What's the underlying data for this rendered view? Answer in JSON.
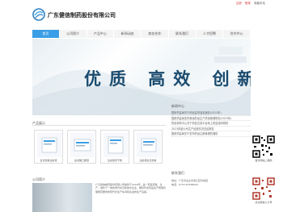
{
  "header": {
    "company_name": "广东健信制药股份有限公司",
    "links": [
      "注册",
      "登录",
      "收藏本站"
    ]
  },
  "nav": {
    "items": [
      "首页",
      "公司简介",
      "产品中心",
      "新闻动态",
      "商务合作",
      "联系我们",
      "人才招聘",
      "合作中心"
    ]
  },
  "banner": {
    "slogan": "优质 高效 创新 共荣"
  },
  "news": {
    "title": "新闻中心",
    "items": [
      "国家药监局关于药品监督抽查通告(2023年)",
      "国家药监局发布新版药品生产质量管理规范(2023年)",
      "药品采购中心关于药品交易平台网上药品挂网规则",
      "2023年度公司生产经营情况总结报告",
      "国家药监局关于发布药品注册管理的通知"
    ]
  },
  "products": {
    "title": "产品展示",
    "items": [
      "生长激素注射液",
      "氨基酸口服液",
      "注射用冻干粉",
      "注射用生长激素"
    ]
  },
  "intro": {
    "title": "公司简介",
    "text": "广东健信制药股份有限公司始建于2004年，是一家集研发、生产、销售于一体的现代化高新技术企业，拥有符合药品生产质量管理规范要求的现代化生产车间和先进的生产设备。"
  },
  "contact": {
    "title": "联系我们",
    "lines": [
      "地址：广东省汕头市濠江区科技园",
      "电话：0754-87588000"
    ]
  },
  "qr": {
    "captions": [
      "官方网站二维码",
      "关注微信公众号"
    ]
  },
  "colors": {
    "accent": "#3a9ee6",
    "link": "#cc3333"
  }
}
